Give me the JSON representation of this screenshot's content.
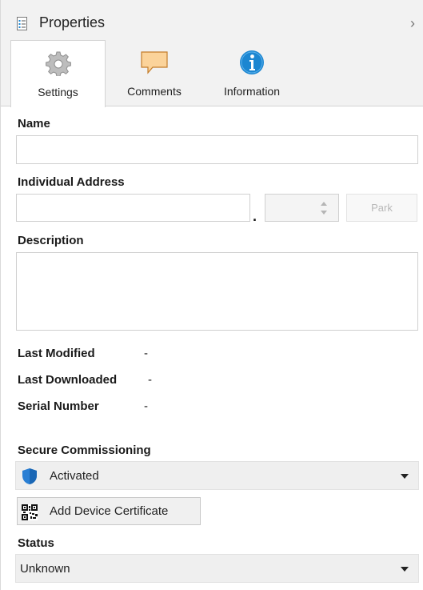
{
  "header": {
    "title": "Properties",
    "icon": "properties-icon",
    "chevron": "›"
  },
  "tabs": [
    {
      "label": "Settings",
      "icon": "gear-icon",
      "active": true
    },
    {
      "label": "Comments",
      "icon": "comment-icon",
      "active": false
    },
    {
      "label": "Information",
      "icon": "info-icon",
      "active": false
    }
  ],
  "form": {
    "name": {
      "label": "Name",
      "value": ""
    },
    "individual_address": {
      "label": "Individual Address",
      "value": "",
      "separator": ".",
      "spinner_value": "",
      "park_label": "Park"
    },
    "description": {
      "label": "Description",
      "value": ""
    },
    "last_modified": {
      "label": "Last Modified",
      "value": "-"
    },
    "last_downloaded": {
      "label": "Last Downloaded",
      "value": "-"
    },
    "serial_number": {
      "label": "Serial Number",
      "value": "-"
    },
    "secure_commissioning": {
      "label": "Secure Commissioning",
      "selected": "Activated",
      "icon": "shield-icon"
    },
    "add_certificate": {
      "label": "Add Device Certificate",
      "icon": "qr-code-icon"
    },
    "status": {
      "label": "Status",
      "selected": "Unknown"
    }
  },
  "colors": {
    "accent_blue": "#1c86d1",
    "shield_blue": "#2a7fd4",
    "comment_orange": "#f0a040",
    "header_bg": "#f2f2f2"
  }
}
